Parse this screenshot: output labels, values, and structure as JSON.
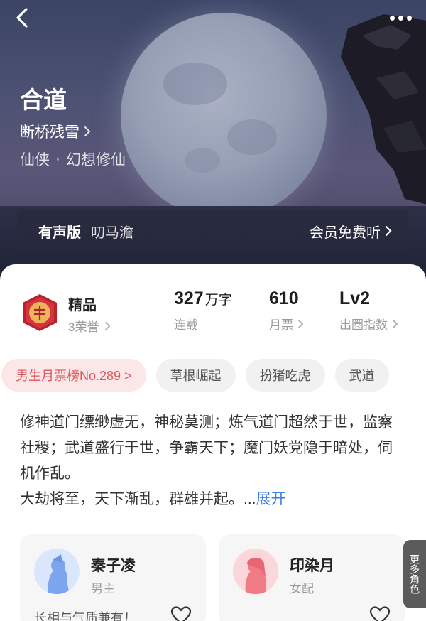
{
  "book": {
    "title": "合道",
    "author": "断桥残雪",
    "genre_primary": "仙侠",
    "genre_sub": "幻想修仙"
  },
  "audio": {
    "label": "有声版",
    "narrator": "叨马澹",
    "free_label": "会员免费听"
  },
  "stats": {
    "badge_title": "精品",
    "badge_sub": "3荣誉",
    "word_count": "327",
    "word_unit": "万字",
    "word_status": "连载",
    "monthly_tickets": "610",
    "monthly_tickets_label": "月票",
    "level": "Lv2",
    "level_label": "出圈指数"
  },
  "tags": [
    {
      "label": "男生月票榜No.289 >"
    },
    {
      "label": "草根崛起"
    },
    {
      "label": "扮猪吃虎"
    },
    {
      "label": "武道"
    }
  ],
  "intro": {
    "text": "修神道门缥缈虚无，神秘莫测；炼气道门超然于世，监察社稷；武道盛行于世，争霸天下；魔门妖党隐于暗处，伺机作乱。\n大劫将至，天下渐乱，群雄并起。...",
    "expand_label": "展开"
  },
  "roles": [
    {
      "name": "秦子凌",
      "type": "男主",
      "desc": "长相与气质兼有！",
      "avatar_color": "#7ba6ef"
    },
    {
      "name": "印染月",
      "type": "女配",
      "desc": "",
      "avatar_color": "#f07a85"
    }
  ],
  "more_roles_label": "更多角色",
  "icons": {
    "back": "chevron-left-icon",
    "more": "more-dots-icon",
    "chevron": "chevron-right-icon",
    "heart": "heart-outline-icon"
  }
}
